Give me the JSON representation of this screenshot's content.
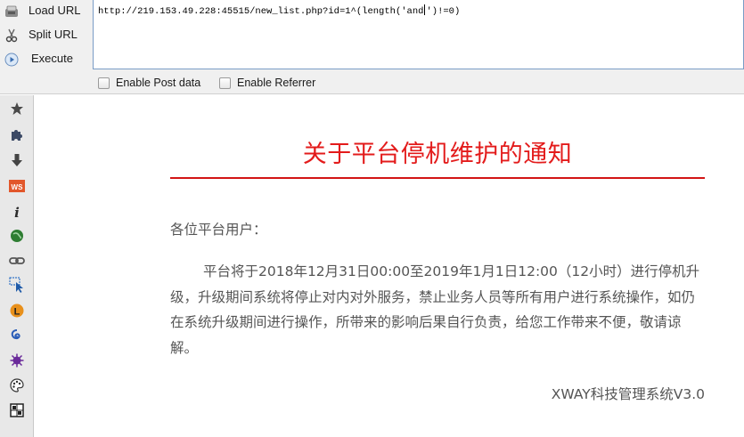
{
  "hackbar": {
    "load_url_label": "Load URL",
    "split_url_label": "Split URL",
    "execute_label": "Execute",
    "url_before_caret": "http://219.153.49.228:45515/new_list.php?id=1^(length('and",
    "url_after_caret": "')!=0)",
    "enable_post_label": "Enable Post data",
    "enable_referrer_label": "Enable Referrer",
    "enable_post_checked": false,
    "enable_referrer_checked": false
  },
  "toolbar": {
    "icons": [
      "star-icon",
      "puzzle-icon",
      "download-arrow-icon",
      "ws-badge-icon",
      "info-icon",
      "green-globe-icon",
      "link-chain-icon",
      "select-cursor-icon",
      "l-badge-icon",
      "swirl-icon",
      "virus-icon",
      "palette-icon",
      "grid-icon"
    ]
  },
  "page": {
    "title": "关于平台停机维护的通知",
    "greeting": "各位平台用户：",
    "body": "平台将于2018年12月31日00:00至2019年1月1日12:00（12小时）进行停机升级，升级期间系统将停止对内对外服务，禁止业务人员等所有用户进行系统操作，如仍在系统升级期间进行操作，所带来的影响后果自行负责，给您工作带来不便，敬请谅解。",
    "signature": "XWAY科技管理系统V3.0"
  },
  "colors": {
    "title_red": "#e31b1b",
    "rule_red": "#d21515",
    "body_gray": "#555555",
    "panel_bg": "#f0f0f0",
    "toolbar_bg": "#e8e8e8"
  }
}
